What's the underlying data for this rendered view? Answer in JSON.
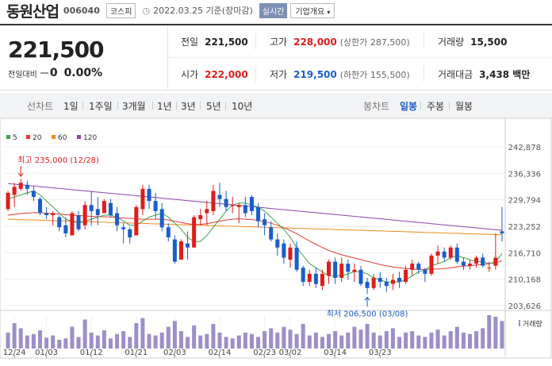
{
  "header": {
    "company": "동원산업",
    "code": "006040",
    "market": "코스피",
    "basis": "2022.03.25 기준(장마감)",
    "realtime_label": "실시간",
    "overview_label": "기업개요"
  },
  "quote": {
    "price": "221,500",
    "change_label": "전일대비",
    "change_value": "0",
    "change_pct": "0.00%",
    "prev_label": "전일",
    "prev_value": "221,500",
    "high_label": "고가",
    "high_value": "228,000",
    "upper_limit": "(상한가 287,500)",
    "volume_label": "거래량",
    "volume_value": "15,500",
    "open_label": "시가",
    "open_value": "222,000",
    "low_label": "저가",
    "low_value": "219,500",
    "lower_limit": "(하한가 155,500)",
    "amount_label": "거래대금",
    "amount_value": "3,438 백만"
  },
  "tabs": {
    "line_label": "선차트",
    "periods": [
      "1일",
      "1주일",
      "3개월",
      "1년",
      "3년",
      "5년",
      "10년"
    ],
    "candle_label": "봉차트",
    "candle_periods": [
      "일봉",
      "주봉",
      "월봉"
    ],
    "active_candle": "일봉"
  },
  "colors": {
    "up": "#e01c1c",
    "down": "#1a5ec9",
    "ma5": "#43a047",
    "ma20": "#e53935",
    "ma60": "#ef8a21",
    "ma120": "#8e44ad",
    "volume": "#9c8fc9"
  },
  "chart_data": {
    "type": "candlestick",
    "legend": [
      {
        "name": "5",
        "color": "#43a047"
      },
      {
        "name": "20",
        "color": "#e53935"
      },
      {
        "name": "60",
        "color": "#ef8a21"
      },
      {
        "name": "120",
        "color": "#8e44ad"
      }
    ],
    "y_ticks": [
      "242,878",
      "236,336",
      "229,794",
      "223,252",
      "216,710",
      "210,168",
      "203,626"
    ],
    "ylim": [
      203626,
      242878
    ],
    "x_ticks": [
      {
        "label": "12/24",
        "index": 1
      },
      {
        "label": "01/03",
        "index": 6
      },
      {
        "label": "01/12",
        "index": 13
      },
      {
        "label": "01/21",
        "index": 20
      },
      {
        "label": "02/03",
        "index": 26
      },
      {
        "label": "02/14",
        "index": 33
      },
      {
        "label": "02/23",
        "index": 40
      },
      {
        "label": "03/02",
        "index": 44
      },
      {
        "label": "03/14",
        "index": 51
      },
      {
        "label": "03/23",
        "index": 58
      }
    ],
    "volume_label": "거래량",
    "annotation_high": "최고 235,000 (12/28)",
    "annotation_low": "최저 206,500 (03/08)",
    "candles": [
      [
        227500,
        231500,
        227000,
        232000
      ],
      [
        231000,
        233000,
        228000,
        234000
      ],
      [
        232500,
        234000,
        232000,
        235000
      ],
      [
        233500,
        232500,
        231000,
        234500
      ],
      [
        232000,
        230500,
        229500,
        233000
      ],
      [
        230000,
        226500,
        226000,
        230500
      ],
      [
        226500,
        226000,
        225000,
        228000
      ],
      [
        226000,
        226500,
        223500,
        227000
      ],
      [
        225500,
        223000,
        222000,
        226000
      ],
      [
        223500,
        221500,
        220500,
        225500
      ],
      [
        221000,
        226500,
        221000,
        227000
      ],
      [
        226000,
        222500,
        222000,
        227000
      ],
      [
        223500,
        228500,
        222500,
        229500
      ],
      [
        228500,
        227000,
        223500,
        232000
      ],
      [
        227500,
        226000,
        223500,
        230500
      ],
      [
        226500,
        229500,
        226500,
        230000
      ],
      [
        229000,
        226000,
        225500,
        230000
      ],
      [
        226500,
        223500,
        222000,
        228000
      ],
      [
        223000,
        222500,
        219000,
        224000
      ],
      [
        222500,
        220500,
        219000,
        223000
      ],
      [
        221000,
        228000,
        221000,
        228500
      ],
      [
        227500,
        232500,
        226000,
        233500
      ],
      [
        232500,
        229500,
        227500,
        233500
      ],
      [
        229500,
        227000,
        225000,
        231500
      ],
      [
        227500,
        223000,
        222000,
        229000
      ],
      [
        223000,
        220500,
        219500,
        224000
      ],
      [
        220000,
        214500,
        214000,
        221000
      ],
      [
        215000,
        219500,
        215000,
        220000
      ],
      [
        219000,
        218000,
        215000,
        222000
      ],
      [
        218000,
        225500,
        218000,
        226000
      ],
      [
        225000,
        226000,
        223500,
        227500
      ],
      [
        226500,
        227500,
        223500,
        229500
      ],
      [
        227000,
        232000,
        226000,
        233500
      ],
      [
        231000,
        230000,
        228000,
        234000
      ],
      [
        230000,
        228000,
        227000,
        232000
      ],
      [
        228500,
        228500,
        226500,
        230500
      ],
      [
        228000,
        228500,
        224000,
        229000
      ],
      [
        228500,
        226500,
        225500,
        230500
      ],
      [
        230500,
        227000,
        226000,
        231000
      ],
      [
        228000,
        224500,
        223000,
        229000
      ],
      [
        225000,
        223500,
        221000,
        226500
      ],
      [
        223000,
        220000,
        219500,
        224500
      ],
      [
        220000,
        218000,
        216000,
        221500
      ],
      [
        219000,
        215500,
        214000,
        220000
      ],
      [
        215000,
        218000,
        213000,
        219000
      ],
      [
        218000,
        212500,
        212000,
        219500
      ],
      [
        213000,
        209500,
        208500,
        213500
      ],
      [
        209500,
        211500,
        208500,
        212500
      ],
      [
        211500,
        209000,
        208000,
        213000
      ],
      [
        208500,
        211500,
        207500,
        212500
      ],
      [
        211000,
        214500,
        209000,
        215000
      ],
      [
        214500,
        210500,
        209000,
        215500
      ],
      [
        210500,
        214000,
        209500,
        215500
      ],
      [
        214000,
        212000,
        210000,
        215000
      ],
      [
        212000,
        212500,
        209500,
        214000
      ],
      [
        212500,
        209000,
        208500,
        213500
      ],
      [
        209500,
        208000,
        206500,
        210500
      ],
      [
        208000,
        210500,
        207500,
        211500
      ],
      [
        210500,
        209500,
        208000,
        212000
      ],
      [
        209500,
        208500,
        207000,
        210500
      ],
      [
        209000,
        210000,
        207500,
        211500
      ],
      [
        210500,
        209500,
        208000,
        212000
      ],
      [
        209500,
        212500,
        209000,
        213500
      ],
      [
        212500,
        214000,
        211000,
        215000
      ],
      [
        214000,
        212500,
        211500,
        214500
      ],
      [
        212500,
        211500,
        209500,
        213000
      ],
      [
        211500,
        216000,
        211000,
        216500
      ],
      [
        216000,
        217000,
        214000,
        218500
      ],
      [
        217000,
        215500,
        214500,
        218000
      ],
      [
        215500,
        218000,
        215000,
        218500
      ],
      [
        218000,
        214500,
        214000,
        219000
      ],
      [
        214500,
        213500,
        212500,
        215500
      ],
      [
        213500,
        214000,
        212500,
        215000
      ],
      [
        214000,
        215500,
        213000,
        216000
      ],
      [
        215500,
        213500,
        213000,
        216500
      ],
      [
        213000,
        213000,
        212000,
        214500
      ],
      [
        213500,
        215500,
        212500,
        221500
      ],
      [
        222000,
        221500,
        219500,
        228000
      ]
    ],
    "ma5": [
      230000,
      230500,
      231000,
      231500,
      232000,
      231000,
      229500,
      228000,
      226500,
      225000,
      224500,
      224000,
      224500,
      225000,
      225500,
      226000,
      226000,
      225500,
      224500,
      223500,
      223500,
      224500,
      225500,
      226000,
      226500,
      225500,
      224000,
      222500,
      220500,
      219500,
      219500,
      221000,
      223000,
      225000,
      227000,
      228500,
      229000,
      229000,
      228500,
      228000,
      227000,
      225500,
      224000,
      222500,
      220500,
      218000,
      216000,
      214000,
      213000,
      212000,
      211000,
      211000,
      211000,
      211500,
      212000,
      212000,
      211500,
      210500,
      210000,
      209500,
      209500,
      209500,
      210000,
      211000,
      212000,
      212500,
      213500,
      214000,
      214500,
      215500,
      216000,
      215500,
      215000,
      214500,
      214500,
      214000,
      214500,
      216500
    ],
    "ma20": [
      226000,
      226200,
      226400,
      226500,
      226600,
      226600,
      226500,
      226400,
      226300,
      226100,
      226000,
      225900,
      225800,
      225700,
      225600,
      225600,
      225500,
      225400,
      225300,
      225200,
      225100,
      225000,
      225000,
      225000,
      225000,
      224800,
      224500,
      224200,
      223900,
      223700,
      223700,
      223900,
      224200,
      224500,
      224800,
      225000,
      225100,
      225000,
      224900,
      224700,
      224400,
      224000,
      223500,
      222900,
      222200,
      221400,
      220500,
      219600,
      218800,
      218000,
      217300,
      216700,
      216200,
      215800,
      215400,
      215000,
      214600,
      214200,
      213800,
      213500,
      213200,
      213000,
      212800,
      212700,
      212600,
      212600,
      212600,
      212700,
      212800,
      213000,
      213200,
      213400,
      213500,
      213700,
      213800,
      214000,
      214300,
      214700
    ],
    "ma60": [
      225000,
      224950,
      224900,
      224850,
      224800,
      224750,
      224700,
      224650,
      224600,
      224550,
      224500,
      224450,
      224400,
      224350,
      224300,
      224250,
      224200,
      224150,
      224100,
      224050,
      224000,
      223950,
      223900,
      223850,
      223800,
      223750,
      223700,
      223650,
      223600,
      223550,
      223500,
      223450,
      223400,
      223350,
      223300,
      223250,
      223200,
      223150,
      223100,
      223050,
      223000,
      222950,
      222900,
      222850,
      222800,
      222750,
      222700,
      222650,
      222600,
      222550,
      222500,
      222450,
      222400,
      222350,
      222300,
      222250,
      222200,
      222150,
      222100,
      222050,
      222000,
      221950,
      221900,
      221850,
      221800,
      221750,
      221700,
      221650,
      221600,
      221550,
      221500,
      221450,
      221400,
      221350,
      221300,
      221250,
      221200,
      221150
    ],
    "ma120": [
      233800,
      233650,
      233500,
      233350,
      233200,
      233050,
      232900,
      232750,
      232600,
      232450,
      232300,
      232150,
      232000,
      231850,
      231700,
      231550,
      231400,
      231250,
      231100,
      230950,
      230800,
      230650,
      230500,
      230350,
      230200,
      230050,
      229900,
      229750,
      229600,
      229450,
      229300,
      229150,
      229000,
      228850,
      228700,
      228550,
      228400,
      228250,
      228100,
      227950,
      227800,
      227650,
      227500,
      227350,
      227200,
      227050,
      226900,
      226750,
      226600,
      226450,
      226300,
      226150,
      226000,
      225850,
      225700,
      225550,
      225400,
      225250,
      225100,
      224950,
      224800,
      224650,
      224500,
      224350,
      224200,
      224050,
      223900,
      223750,
      223600,
      223450,
      223300,
      223150,
      223000,
      222850,
      222700,
      222550,
      222400,
      222250
    ],
    "volume": [
      22,
      35,
      28,
      18,
      20,
      25,
      15,
      18,
      12,
      14,
      30,
      16,
      40,
      22,
      18,
      25,
      14,
      20,
      24,
      16,
      35,
      42,
      20,
      18,
      22,
      30,
      38,
      24,
      16,
      32,
      18,
      20,
      34,
      22,
      16,
      14,
      18,
      22,
      20,
      16,
      24,
      28,
      22,
      30,
      26,
      20,
      34,
      18,
      22,
      16,
      20,
      24,
      18,
      22,
      30,
      26,
      34,
      22,
      18,
      24,
      28,
      16,
      22,
      24,
      18,
      16,
      22,
      26,
      18,
      24,
      30,
      22,
      20,
      24,
      28,
      46,
      44,
      38
    ]
  }
}
